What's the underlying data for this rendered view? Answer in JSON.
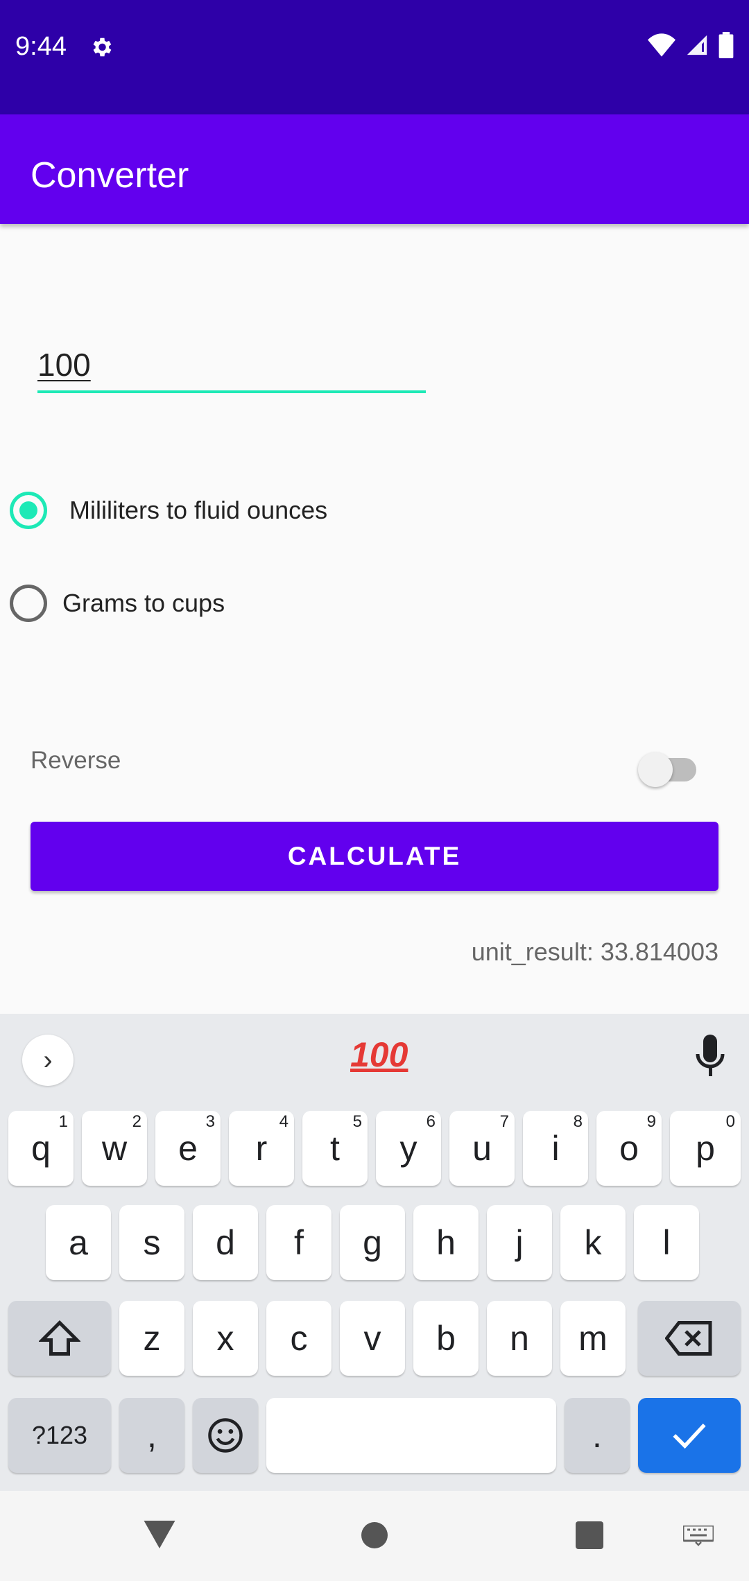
{
  "status": {
    "time": "9:44"
  },
  "app": {
    "title": "Converter"
  },
  "input": {
    "value": "100"
  },
  "radios": [
    {
      "label": "Mililiters to fluid ounces",
      "checked": true
    },
    {
      "label": "Grams to cups",
      "checked": false
    }
  ],
  "reverse": {
    "label": "Reverse",
    "on": false
  },
  "calculate": {
    "label": "CALCULATE"
  },
  "result": {
    "text": "unit_result: 33.814003"
  },
  "keyboard": {
    "emoji_suggestion": "100",
    "row1": [
      {
        "l": "q",
        "n": "1"
      },
      {
        "l": "w",
        "n": "2"
      },
      {
        "l": "e",
        "n": "3"
      },
      {
        "l": "r",
        "n": "4"
      },
      {
        "l": "t",
        "n": "5"
      },
      {
        "l": "y",
        "n": "6"
      },
      {
        "l": "u",
        "n": "7"
      },
      {
        "l": "i",
        "n": "8"
      },
      {
        "l": "o",
        "n": "9"
      },
      {
        "l": "p",
        "n": "0"
      }
    ],
    "row2": [
      "a",
      "s",
      "d",
      "f",
      "g",
      "h",
      "j",
      "k",
      "l"
    ],
    "row3": [
      "z",
      "x",
      "c",
      "v",
      "b",
      "n",
      "m"
    ],
    "sym_label": "?123",
    "comma": ",",
    "period": "."
  }
}
